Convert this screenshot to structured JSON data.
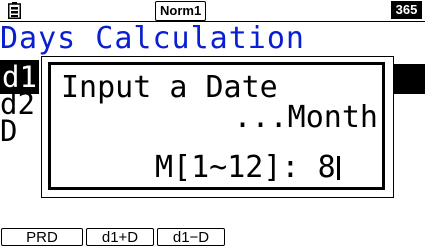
{
  "status_bar": {
    "battery_icon": "battery-icon",
    "angle_mode": "Norm1",
    "mode_badge": "365"
  },
  "screen": {
    "title": "Days Calculation",
    "lines": {
      "d1_prefix": "d1",
      "d2_prefix": "d2",
      "d_prefix": "D"
    }
  },
  "dialog": {
    "title": "Input a Date",
    "subtitle": "...Month",
    "input_label": "M[1~12]:",
    "input_value": "8"
  },
  "function_keys": [
    {
      "label": "PRD"
    },
    {
      "label": "d1+D"
    },
    {
      "label": "d1−D"
    }
  ],
  "colors": {
    "title": "#0a1fd0",
    "foreground": "#000000",
    "background": "#ffffff"
  }
}
